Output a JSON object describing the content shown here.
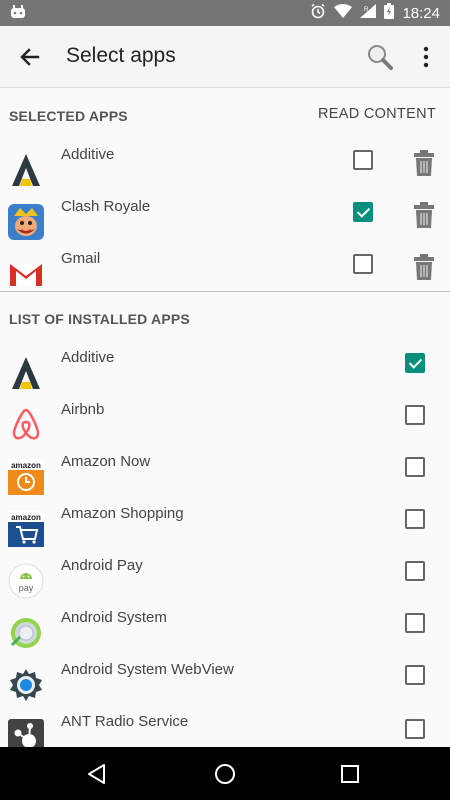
{
  "status_bar": {
    "time": "18:24"
  },
  "app_bar": {
    "title": "Select apps"
  },
  "selected_section": {
    "header": "SELECTED APPS",
    "read_content_label": "READ CONTENT",
    "items": [
      {
        "label": "Additive",
        "checked": false
      },
      {
        "label": "Clash Royale",
        "checked": true
      },
      {
        "label": "Gmail",
        "checked": false
      }
    ]
  },
  "installed_section": {
    "header": "LIST OF INSTALLED APPS",
    "items": [
      {
        "label": "Additive",
        "checked": true
      },
      {
        "label": "Airbnb",
        "checked": false
      },
      {
        "label": "Amazon Now",
        "checked": false
      },
      {
        "label": "Amazon Shopping",
        "checked": false
      },
      {
        "label": "Android Pay",
        "checked": false
      },
      {
        "label": "Android System",
        "checked": false
      },
      {
        "label": "Android System WebView",
        "checked": false
      },
      {
        "label": "ANT Radio Service",
        "checked": false
      }
    ]
  },
  "icon_text": {
    "amazon": "amazon",
    "pay": "pay"
  },
  "colors": {
    "accent": "#0a8f7f",
    "status_bar": "#757575",
    "nav_bar": "#000000"
  }
}
